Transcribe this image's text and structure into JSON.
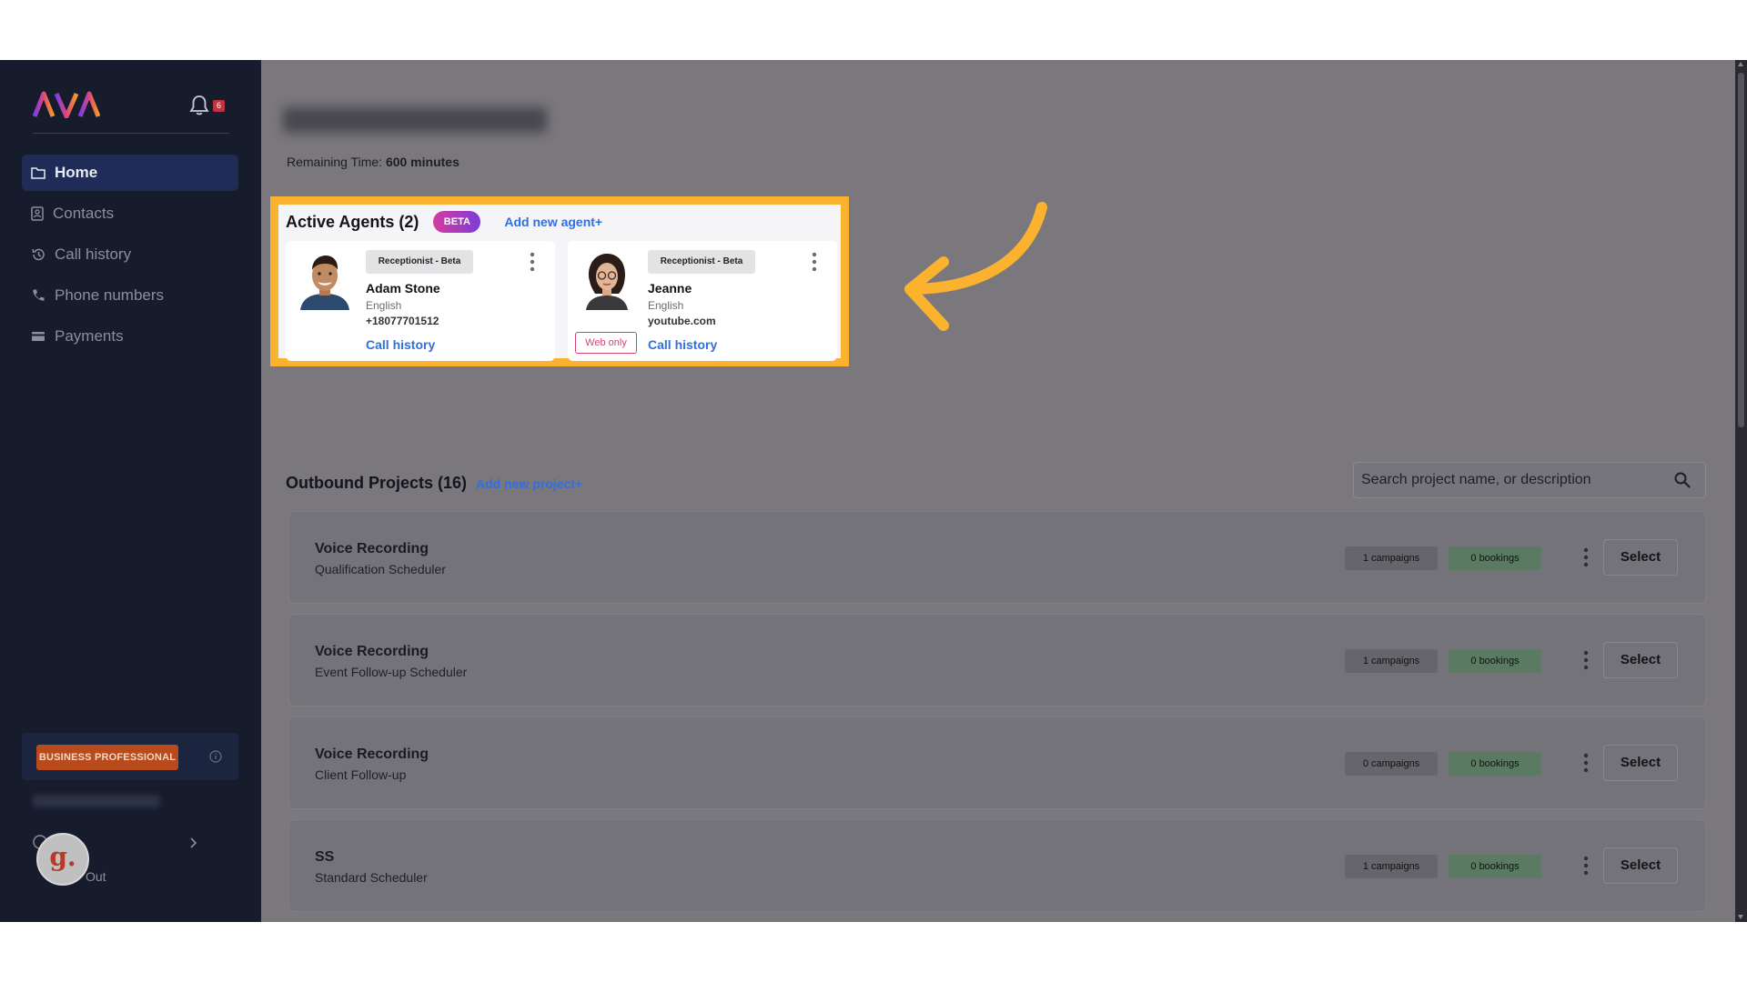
{
  "app": {
    "logo_text": "AVA",
    "notification_count": "6"
  },
  "sidebar": {
    "items": [
      {
        "label": "Home",
        "icon": "folder-icon",
        "active": true
      },
      {
        "label": "Contacts",
        "icon": "contacts-icon"
      },
      {
        "label": "Call history",
        "icon": "history-icon"
      },
      {
        "label": "Phone numbers",
        "icon": "phone-icon"
      },
      {
        "label": "Payments",
        "icon": "card-icon"
      }
    ],
    "plan_label": "BUSINESS PROFESSIONAL",
    "signout_label": "Out"
  },
  "main": {
    "remaining_label": "Remaining Time:",
    "remaining_value": "600 minutes",
    "agents": {
      "title": "Active Agents (2)",
      "beta": "BETA",
      "add_label": "Add new agent+",
      "cards": [
        {
          "role": "Receptionist - Beta",
          "name": "Adam Stone",
          "language": "English",
          "contact": "+18077701512",
          "link": "Call history"
        },
        {
          "role": "Receptionist - Beta",
          "name": "Jeanne",
          "language": "English",
          "contact": "youtube.com",
          "link": "Call history",
          "badge": "Web only"
        }
      ]
    },
    "outbound": {
      "title": "Outbound Projects (16)",
      "add_label": "Add new project+",
      "search_placeholder": "Search project name, or description",
      "projects": [
        {
          "name": "Voice Recording",
          "description": "Qualification Scheduler",
          "campaigns": "1 campaigns",
          "bookings": "0 bookings",
          "action": "Select"
        },
        {
          "name": "Voice Recording",
          "description": "Event Follow-up Scheduler",
          "campaigns": "1 campaigns",
          "bookings": "0 bookings",
          "action": "Select"
        },
        {
          "name": "Voice Recording",
          "description": "Client Follow-up",
          "campaigns": "0 campaigns",
          "bookings": "0 bookings",
          "action": "Select"
        },
        {
          "name": "SS",
          "description": "Standard Scheduler",
          "campaigns": "1 campaigns",
          "bookings": "0 bookings",
          "action": "Select"
        }
      ]
    }
  },
  "colors": {
    "highlight": "#fbb22e",
    "link": "#2f6fe0",
    "sidebar_bg": "#161c2c",
    "nav_active": "#1f2c57",
    "plan_badge": "#b84a1b"
  },
  "annotation": {
    "arrow_icon": "curved-arrow-icon",
    "avatar_letter": "g."
  }
}
